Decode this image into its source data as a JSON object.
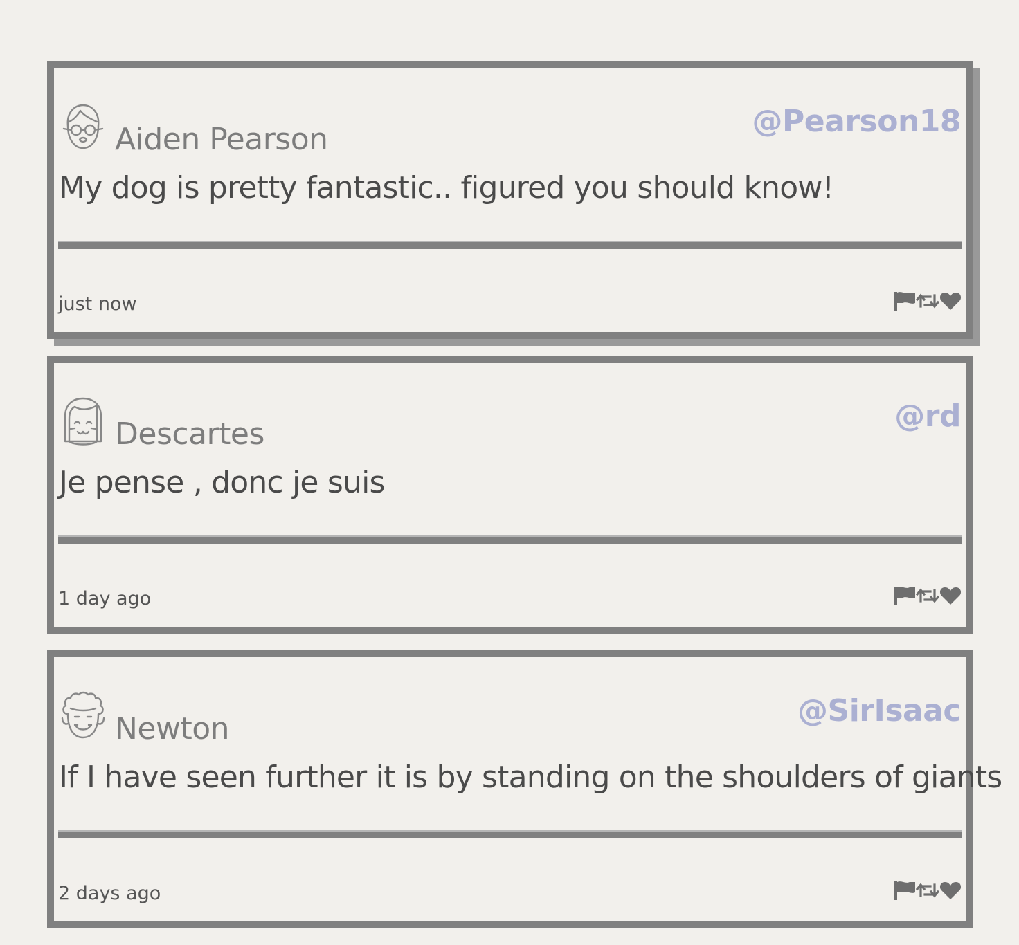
{
  "tweets": [
    {
      "name": "Aiden Pearson",
      "handle": "@Pearson18",
      "message": "My dog is pretty fantastic.. figured you should know!",
      "time": "just now",
      "avatar_icon": "glasses-face-icon",
      "hovered": true
    },
    {
      "name": "Descartes",
      "handle": "@rd",
      "message": "Je pense , donc je suis",
      "time": "1 day ago",
      "avatar_icon": "bangs-face-icon",
      "hovered": false
    },
    {
      "name": "Newton",
      "handle": "@SirIsaac",
      "message": "If I have seen further it is by standing on the shoulders of giants",
      "time": "2 days ago",
      "avatar_icon": "curly-hair-face-icon",
      "hovered": false
    }
  ],
  "action_icons": [
    "flag-icon",
    "retweet-icon",
    "heart-icon"
  ],
  "colors": {
    "background": "#f2f0ec",
    "border": "#808080",
    "handle": "#abb0d2",
    "name": "#7d7d7d",
    "message": "#4a4a4a"
  }
}
